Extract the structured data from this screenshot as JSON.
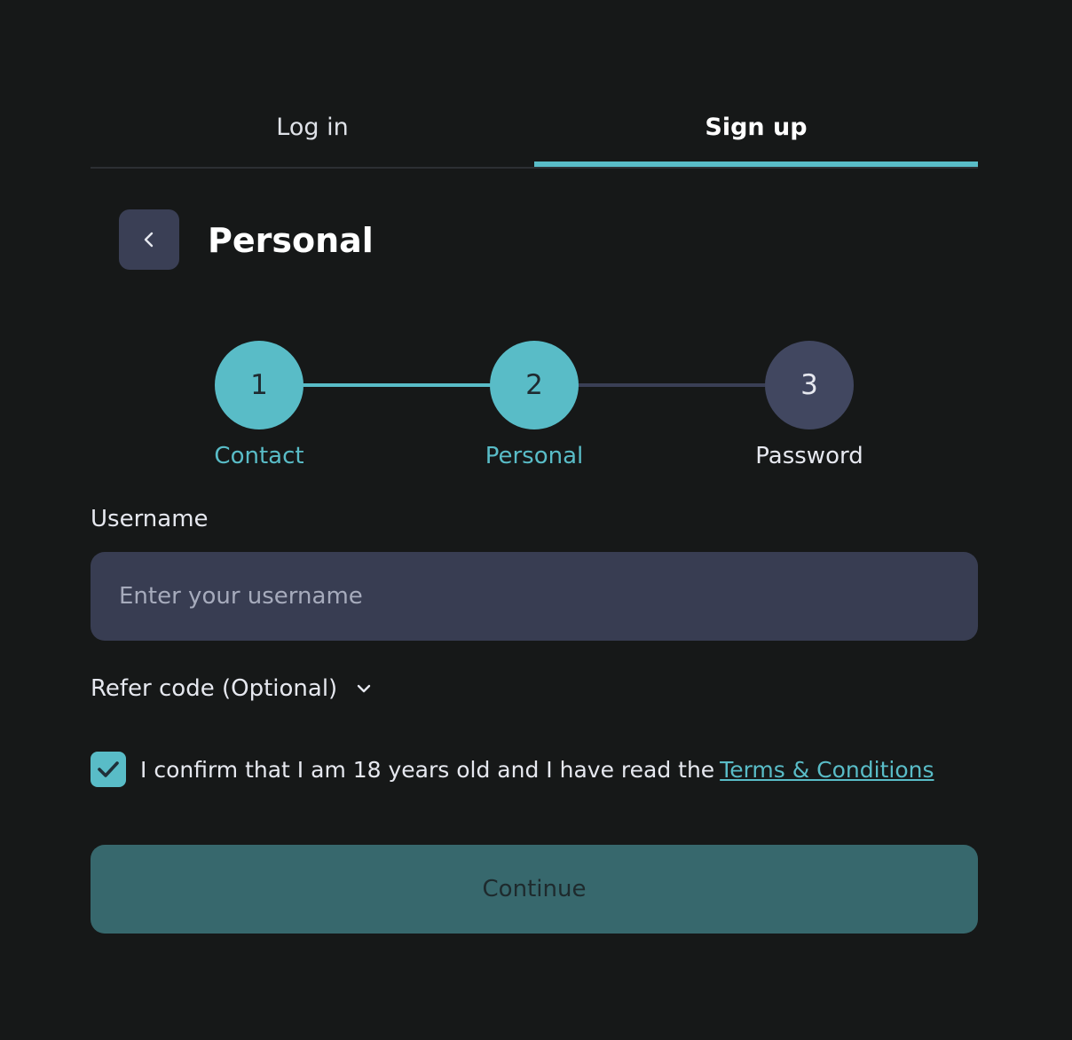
{
  "tabs": [
    {
      "label": "Log in",
      "active": false
    },
    {
      "label": "Sign up",
      "active": true
    }
  ],
  "header": {
    "title": "Personal",
    "back_icon": "chevron-left-icon"
  },
  "stepper": {
    "steps": [
      {
        "number": "1",
        "label": "Contact",
        "state": "completed"
      },
      {
        "number": "2",
        "label": "Personal",
        "state": "current"
      },
      {
        "number": "3",
        "label": "Password",
        "state": "upcoming"
      }
    ]
  },
  "username": {
    "label": "Username",
    "placeholder": "Enter your username",
    "value": ""
  },
  "refer_code": {
    "label": "Refer code (Optional)",
    "icon": "chevron-down-icon"
  },
  "confirm": {
    "checked": true,
    "text": "I confirm that I am 18 years old and I have read the",
    "link_text": "Terms & Conditions"
  },
  "continue_button": {
    "label": "Continue"
  },
  "colors": {
    "background": "#161818",
    "accent": "#59bcc7",
    "input_bg": "#383d52",
    "continue_bg": "#37686d",
    "inactive_step": "#414760"
  }
}
